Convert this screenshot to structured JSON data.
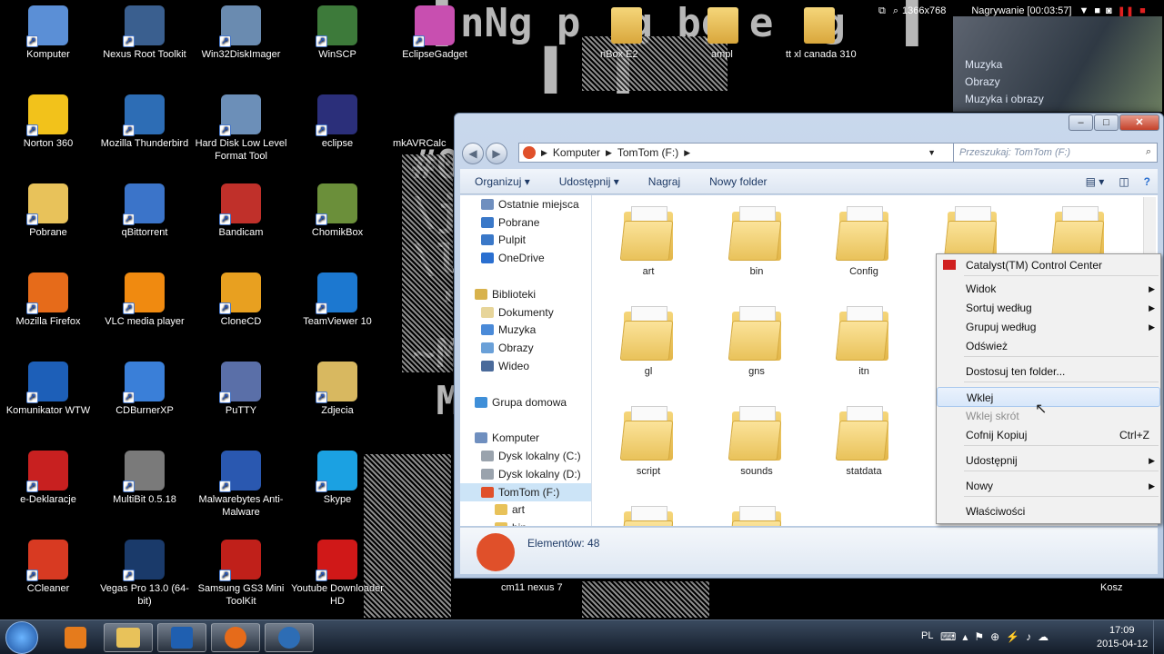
{
  "desktop": {
    "icons": [
      {
        "label": "Komputer",
        "icon": "computer-icon",
        "color": "#5b8fd6"
      },
      {
        "label": "Nexus Root Toolkit",
        "icon": "nexus-toolkit-icon",
        "color": "#3a5f8f"
      },
      {
        "label": "Win32DiskImager",
        "icon": "disk-imager-icon",
        "color": "#6a8bb0"
      },
      {
        "label": "WinSCP",
        "icon": "winscp-icon",
        "color": "#3d7a3a"
      },
      {
        "label": "EclipseGadget",
        "icon": "eclipse-gadget-icon",
        "color": "#c84fb0"
      },
      {
        "label": "Norton 360",
        "icon": "norton-icon",
        "color": "#f2c21b"
      },
      {
        "label": "Mozilla Thunderbird",
        "icon": "thunderbird-icon",
        "color": "#2d6db5"
      },
      {
        "label": "Hard Disk Low Level Format Tool",
        "icon": "hdd-format-icon",
        "color": "#6c8fb8"
      },
      {
        "label": "eclipse",
        "icon": "eclipse-icon",
        "color": "#2b2f7a"
      },
      {
        "label": "Pobrane",
        "icon": "downloads-folder-icon",
        "color": "#e8c25a"
      },
      {
        "label": "qBittorrent",
        "icon": "qbittorrent-icon",
        "color": "#3b74c9"
      },
      {
        "label": "Bandicam",
        "icon": "bandicam-icon",
        "color": "#c0302a"
      },
      {
        "label": "ChomikBox",
        "icon": "chomikbox-icon",
        "color": "#6b8f3a"
      },
      {
        "label": "Mozilla Firefox",
        "icon": "firefox-icon",
        "color": "#e66b1a"
      },
      {
        "label": "VLC media player",
        "icon": "vlc-icon",
        "color": "#f08a10"
      },
      {
        "label": "CloneCD",
        "icon": "clonecd-icon",
        "color": "#e8a020"
      },
      {
        "label": "TeamViewer 10",
        "icon": "teamviewer-icon",
        "color": "#1c78d0"
      },
      {
        "label": "Komunikator WTW",
        "icon": "wtw-icon",
        "color": "#1d5fb8"
      },
      {
        "label": "CDBurnerXP",
        "icon": "cdburner-icon",
        "color": "#3a7fd8"
      },
      {
        "label": "PuTTY",
        "icon": "putty-icon",
        "color": "#5a6fa8"
      },
      {
        "label": "Zdjecia",
        "icon": "photos-folder-icon",
        "color": "#d8b860"
      },
      {
        "label": "e-Deklaracje",
        "icon": "e-deklaracje-icon",
        "color": "#c82020"
      },
      {
        "label": "MultiBit 0.5.18",
        "icon": "multibit-icon",
        "color": "#7a7a7a"
      },
      {
        "label": "Malwarebytes Anti-Malware",
        "icon": "malwarebytes-icon",
        "color": "#2a58b0"
      },
      {
        "label": "Skype",
        "icon": "skype-icon",
        "color": "#1ba1e2"
      },
      {
        "label": "CCleaner",
        "icon": "ccleaner-icon",
        "color": "#d83a22"
      },
      {
        "label": "Vegas Pro 13.0 (64-bit)",
        "icon": "vegas-pro-icon",
        "color": "#1a3a6a"
      },
      {
        "label": "Samsung GS3 Mini ToolKit",
        "icon": "samsung-toolkit-icon",
        "color": "#c0201a"
      },
      {
        "label": "Youtube Downloader HD",
        "icon": "youtube-downloader-icon",
        "color": "#d01818"
      }
    ],
    "background_labels": [
      "nBox E2",
      "ampl",
      "tt xl canada 310",
      "mkAVRCalc",
      "cm11 nexus 7",
      "Kosz"
    ]
  },
  "recorder": {
    "resolution": "1366x768",
    "status": "Nagrywanie [00:03:57]"
  },
  "media_gadget": {
    "items": [
      "Muzyka",
      "Obrazy",
      "Muzyka i obrazy"
    ]
  },
  "explorer": {
    "address": {
      "segments": [
        "Komputer",
        "TomTom (F:)"
      ]
    },
    "search_placeholder": "Przeszukaj: TomTom (F:)",
    "toolbar": {
      "organize": "Organizuj",
      "share": "Udostępnij",
      "burn": "Nagraj",
      "new_folder": "Nowy folder"
    },
    "nav": [
      {
        "label": "Ostatnie miejsca",
        "indent": 1,
        "color": "#6f8fbf"
      },
      {
        "label": "Pobrane",
        "indent": 1,
        "color": "#3a78c8"
      },
      {
        "label": "Pulpit",
        "indent": 1,
        "color": "#3a78c8"
      },
      {
        "label": "OneDrive",
        "indent": 1,
        "color": "#2a6fd0"
      },
      {
        "label": "",
        "indent": 0,
        "color": ""
      },
      {
        "label": "Biblioteki",
        "indent": 0,
        "color": "#d8b24c"
      },
      {
        "label": "Dokumenty",
        "indent": 1,
        "color": "#e7d59a"
      },
      {
        "label": "Muzyka",
        "indent": 1,
        "color": "#4a8ad8"
      },
      {
        "label": "Obrazy",
        "indent": 1,
        "color": "#6aa0d8"
      },
      {
        "label": "Wideo",
        "indent": 1,
        "color": "#4a6a9a"
      },
      {
        "label": "",
        "indent": 0,
        "color": ""
      },
      {
        "label": "Grupa domowa",
        "indent": 0,
        "color": "#3f8fd8"
      },
      {
        "label": "",
        "indent": 0,
        "color": ""
      },
      {
        "label": "Komputer",
        "indent": 0,
        "color": "#6f8fbf"
      },
      {
        "label": "Dysk lokalny (C:)",
        "indent": 1,
        "color": "#9aa3ad"
      },
      {
        "label": "Dysk lokalny (D:)",
        "indent": 1,
        "color": "#9aa3ad"
      },
      {
        "label": "TomTom (F:)",
        "indent": 1,
        "color": "#e0502a"
      },
      {
        "label": "art",
        "indent": 2,
        "color": "#e8c25a"
      },
      {
        "label": "bin",
        "indent": 2,
        "color": "#e8c25a"
      }
    ],
    "folders": [
      "art",
      "bin",
      "Config",
      "",
      "",
      "gl",
      "gns",
      "itn",
      "script",
      "sounds",
      "statdata"
    ],
    "details": {
      "count_label": "Elementów: 48"
    }
  },
  "context_menu": {
    "items": [
      {
        "label": "Catalyst(TM) Control Center",
        "type": "app"
      },
      {
        "label": "Widok",
        "type": "submenu"
      },
      {
        "label": "Sortuj według",
        "type": "submenu"
      },
      {
        "label": "Grupuj według",
        "type": "submenu"
      },
      {
        "label": "Odśwież",
        "type": "item"
      },
      {
        "label": "Dostosuj ten folder...",
        "type": "item"
      },
      {
        "label": "Wklej",
        "type": "highlighted"
      },
      {
        "label": "Wklej skrót",
        "type": "disabled"
      },
      {
        "label": "Cofnij Kopiuj",
        "type": "item",
        "shortcut": "Ctrl+Z"
      },
      {
        "label": "Udostępnij",
        "type": "submenu"
      },
      {
        "label": "Nowy",
        "type": "submenu"
      },
      {
        "label": "Właściwości",
        "type": "item"
      }
    ]
  },
  "taskbar": {
    "language": "PL",
    "time": "17:09",
    "date": "2015-04-12"
  }
}
